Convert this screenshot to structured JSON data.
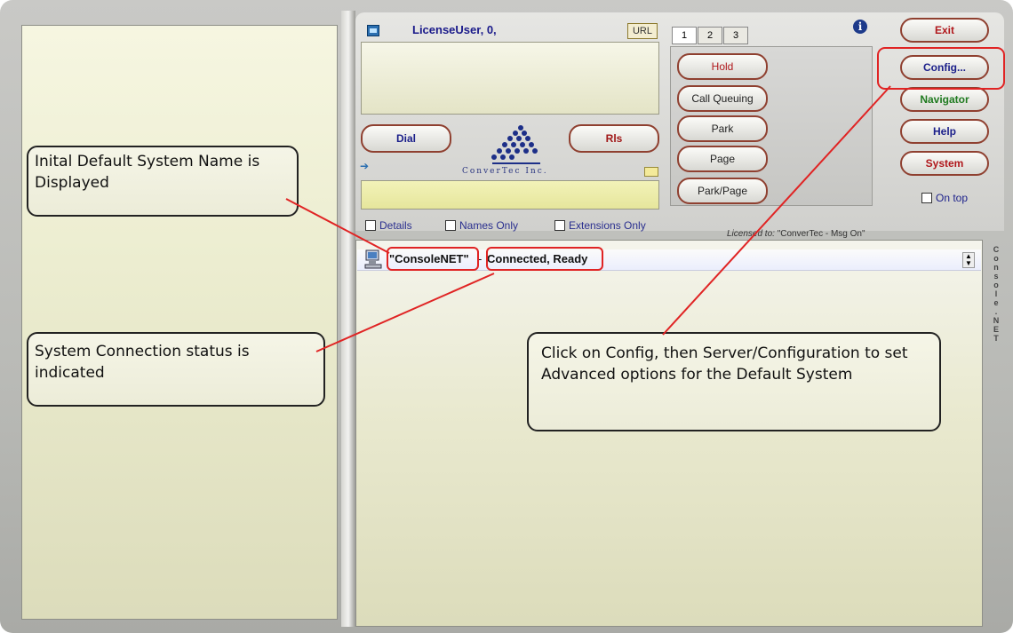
{
  "header": {
    "license_user": "LicenseUser, 0,",
    "url_button": "URL"
  },
  "call": {
    "dial_label": "Dial",
    "release_label": "Rls",
    "logo_text": "ConverTec Inc."
  },
  "tabs": [
    "1",
    "2",
    "3"
  ],
  "feature_buttons": [
    "Hold",
    "Call Queuing",
    "Park",
    "Page",
    "Park/Page"
  ],
  "right_buttons": [
    {
      "label": "Exit",
      "color": "#b0181c"
    },
    {
      "label": "Config...",
      "color": "#1b1f8a"
    },
    {
      "label": "Navigator",
      "color": "#1f7a1f"
    },
    {
      "label": "Help",
      "color": "#1b1f8a"
    },
    {
      "label": "System",
      "color": "#b0181c"
    }
  ],
  "on_top": {
    "label": "On top",
    "checked": false
  },
  "filters": [
    {
      "label": "Details",
      "checked": false
    },
    {
      "label": "Names Only",
      "checked": false
    },
    {
      "label": "Extensions Only",
      "checked": false
    }
  ],
  "licensed": {
    "prefix": "Licensed to:",
    "value": "\"ConverTec - Msg On\""
  },
  "system": {
    "name": "\"ConsoleNET\"",
    "separator": "-",
    "status": "Connected, Ready"
  },
  "side_label": "Console.NET",
  "annotations": {
    "system_name": "Inital Default System Name is Displayed",
    "connection_status": "System Connection status is indicated",
    "config_hint": "Click on Config, then Server/Configuration to set Advanced  options for the Default System"
  },
  "colors": {
    "annotation_line": "#e02424",
    "highlight_box": "#e02424"
  }
}
